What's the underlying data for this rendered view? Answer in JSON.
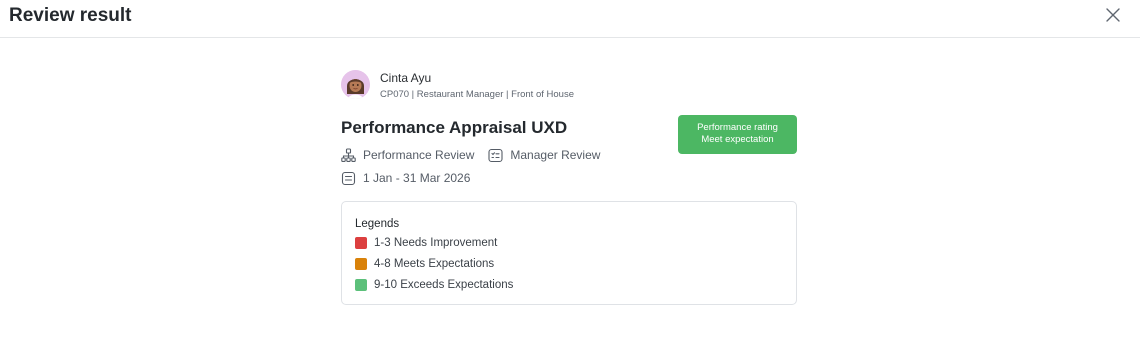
{
  "header": {
    "title": "Review result",
    "close_icon": "close-icon"
  },
  "employee": {
    "name": "Cinta Ayu",
    "meta": "CP070 | Restaurant Manager | Front of House",
    "avatar_icon": "avatar-illustration"
  },
  "review": {
    "title": "Performance Appraisal UXD",
    "type": "Performance Review",
    "type_icon": "org-chart-icon",
    "reviewer": "Manager Review",
    "reviewer_icon": "checklist-icon",
    "period": "1 Jan - 31 Mar 2026",
    "period_icon": "calendar-icon"
  },
  "rating": {
    "label": "Performance rating",
    "value": "Meet expectation",
    "color": "#4cb763"
  },
  "legends": {
    "title": "Legends",
    "items": [
      {
        "label": "1-3 Needs Improvement",
        "color": "#dc3f3f"
      },
      {
        "label": "4-8 Meets Expectations",
        "color": "#d9820a"
      },
      {
        "label": "9-10 Exceeds Expectations",
        "color": "#5cc07a"
      }
    ]
  }
}
